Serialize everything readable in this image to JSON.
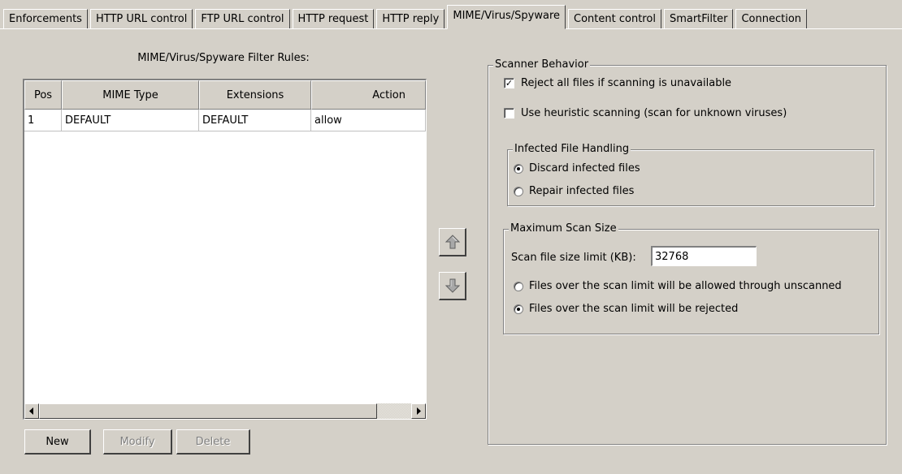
{
  "tabs": [
    {
      "label": "Enforcements"
    },
    {
      "label": "HTTP URL control"
    },
    {
      "label": "FTP URL control"
    },
    {
      "label": "HTTP request"
    },
    {
      "label": "HTTP reply"
    },
    {
      "label": "MIME/Virus/Spyware",
      "active": true
    },
    {
      "label": "Content control"
    },
    {
      "label": "SmartFilter"
    },
    {
      "label": "Connection"
    }
  ],
  "rules": {
    "title": "MIME/Virus/Spyware Filter Rules:",
    "columns": [
      "Pos",
      "MIME Type",
      "Extensions",
      "Action"
    ],
    "rows": [
      {
        "pos": "1",
        "mime_type": "DEFAULT",
        "extensions": "DEFAULT",
        "action": "allow"
      }
    ]
  },
  "buttons": {
    "new": "New",
    "modify": "Modify",
    "delete": "Delete"
  },
  "scanner": {
    "legend": "Scanner Behavior",
    "reject_unavailable": {
      "label": "Reject all files if scanning is unavailable",
      "checked": true
    },
    "heuristic": {
      "label": "Use heuristic scanning (scan for unknown viruses)",
      "checked": false
    },
    "infected": {
      "legend": "Infected File Handling",
      "options": [
        {
          "label": "Discard infected files",
          "selected": true
        },
        {
          "label": "Repair infected files",
          "selected": false
        }
      ]
    },
    "max_scan": {
      "legend": "Maximum Scan Size",
      "limit_label": "Scan file size limit (KB):",
      "limit_value": "32768",
      "options": [
        {
          "label": "Files over the scan limit will be allowed through unscanned",
          "selected": false
        },
        {
          "label": "Files over the scan limit will be rejected",
          "selected": true
        }
      ]
    }
  }
}
